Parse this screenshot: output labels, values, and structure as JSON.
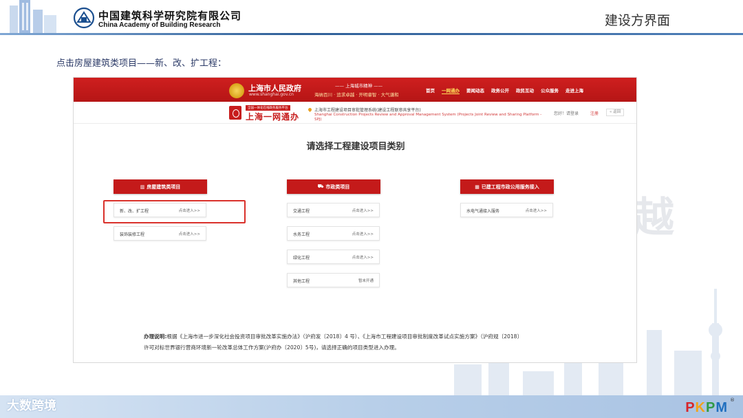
{
  "header": {
    "org_name_cn": "中国建筑科学研究院有限公司",
    "org_name_en": "China Academy of Building Research",
    "slide_title": "建设方界面",
    "logo_icon": "cabr-logo-icon",
    "decoration_icon": "city-buildings-icon"
  },
  "instruction": "点击房屋建筑类项目——新、改、扩工程：",
  "site": {
    "gov_title": "上海市人民政府",
    "gov_url": "www.shanghai.gov.cn",
    "slogan_top": "—— 上海城市精神 ——",
    "slogan_bottom": "海纳百川 · 追求卓越 · 开明睿智 · 大气谦和",
    "nav": [
      "首页",
      "一网通办",
      "要闻动态",
      "政务公开",
      "政民互动",
      "公众服务",
      "走进上海"
    ],
    "nav_active_index": 1,
    "onenet_tag": "全国一体化在线政务服务平台",
    "onenet_name": "上海一网通办",
    "system_name_cn": "上海市工程建设项目审批管理系统(建设工程联审共享平台)",
    "system_name_en": "Shanghai Construction Projects Review and Approval Management System (Projects Joint Review and Sharing Platform -SPJ)",
    "login_text": "您好！请登录",
    "register_text": "注册",
    "back_label": "返回",
    "heading": "请选择工程建设项目类别",
    "categories": [
      {
        "title": "房屋建筑类项目",
        "icon": "building-icon",
        "items": [
          {
            "name": "新、改、扩工程",
            "action": "点击进入>>"
          },
          {
            "name": "装饰装修工程",
            "action": "点击进入>>"
          }
        ]
      },
      {
        "title": "市政类项目",
        "icon": "road-icon",
        "items": [
          {
            "name": "交通工程",
            "action": "点击进入>>"
          },
          {
            "name": "水务工程",
            "action": "点击进入>>"
          },
          {
            "name": "绿化工程",
            "action": "点击进入>>"
          },
          {
            "name": "其他工程",
            "action": "暂未开通"
          }
        ]
      },
      {
        "title": "已建工程市政公用服务接入",
        "icon": "pipe-icon",
        "items": [
          {
            "name": "水电气通接入服务",
            "action": "点击进入>>"
          }
        ]
      }
    ],
    "notice_label": "办理说明:",
    "notice_line1": "根据《上海市进一步深化社会投资项目审批改革实施办法》（沪府发〔2018〕4 号）、《上海市工程建设项目审批制度改革试点实施方案》（沪府规〔2018〕",
    "notice_line2": "许可对标世界银行营商环境新一轮改革总体工作方案(沪府办〔2020〕5号)，请选择正确的项目类型进入办理。"
  },
  "watermark": "大数跨境",
  "brand": {
    "text": "PKPM",
    "letters": [
      {
        "char": "P",
        "color": "#d7262b"
      },
      {
        "char": "K",
        "color": "#f2a31b"
      },
      {
        "char": "P",
        "color": "#2f9a45"
      },
      {
        "char": "M",
        "color": "#1f6fbf"
      }
    ],
    "registered_mark": "®"
  },
  "colors": {
    "gov_red": "#c41a1a",
    "highlight_red": "#d9302a",
    "header_rule": "#2f5f98"
  }
}
